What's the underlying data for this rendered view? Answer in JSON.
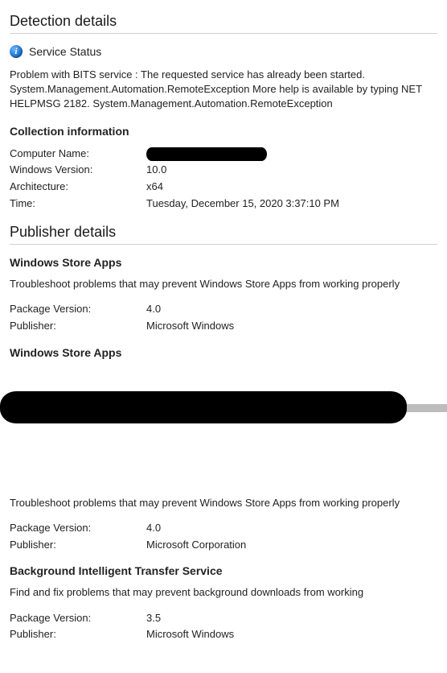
{
  "detection": {
    "title": "Detection details",
    "status_label": "Service Status",
    "problem_text": "Problem with BITS service : The requested service has already been started. System.Management.Automation.RemoteException More help is available by typing NET HELPMSG 2182. System.Management.Automation.RemoteException"
  },
  "collection": {
    "heading": "Collection information",
    "rows": {
      "computer_name_label": "Computer Name:",
      "computer_name_value": "[redacted]",
      "windows_version_label": "Windows Version:",
      "windows_version_value": "10.0",
      "architecture_label": "Architecture:",
      "architecture_value": "x64",
      "time_label": "Time:",
      "time_value": "Tuesday, December 15, 2020 3:37:10 PM"
    }
  },
  "publisher": {
    "title": "Publisher details",
    "sections": [
      {
        "heading": "Windows Store Apps",
        "description": "Troubleshoot problems that may prevent Windows Store Apps from working properly",
        "package_version_label": "Package Version:",
        "package_version_value": "4.0",
        "publisher_label": "Publisher:",
        "publisher_value": "Microsoft Windows"
      },
      {
        "heading": "Windows Store Apps",
        "redacted_block": true,
        "description": "Troubleshoot problems that may prevent Windows Store Apps from working properly",
        "package_version_label": "Package Version:",
        "package_version_value": "4.0",
        "publisher_label": "Publisher:",
        "publisher_value": "Microsoft Corporation"
      },
      {
        "heading": "Background Intelligent Transfer Service",
        "description": "Find and fix problems that may prevent background downloads from working",
        "package_version_label": "Package Version:",
        "package_version_value": "3.5",
        "publisher_label": "Publisher:",
        "publisher_value": "Microsoft Windows"
      }
    ]
  }
}
